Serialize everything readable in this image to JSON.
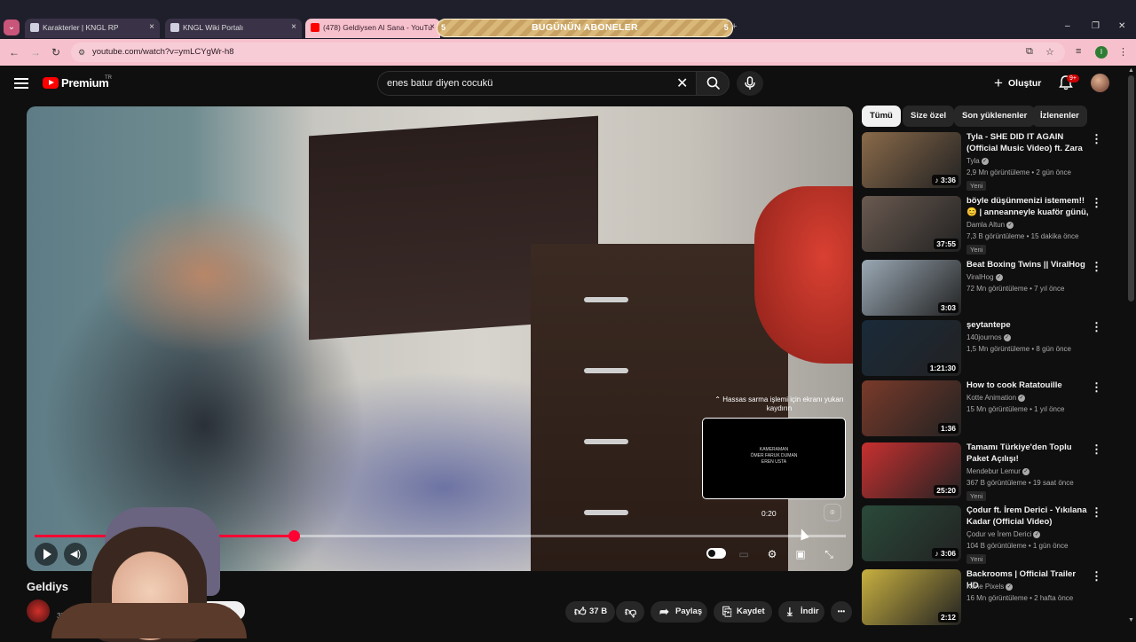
{
  "browser": {
    "tabs": [
      {
        "title": "Karakterler | KNGL RP",
        "close": "×"
      },
      {
        "title": "KNGL Wiki Portalı",
        "close": "×"
      },
      {
        "title": "(478) Geldiysen Al Sana - YouTu",
        "close": "×"
      }
    ],
    "banner": {
      "text": "BUGÜNÜN ABONELER",
      "left_num": "5",
      "right_num": "5"
    },
    "new_tab": "+",
    "url": "youtube.com/watch?v=ymLCYgWr-h8",
    "window_controls": [
      "–",
      "❐",
      "✕"
    ],
    "profile_letter": "I"
  },
  "header": {
    "logo_text": "Premium",
    "logo_region": "TR",
    "search_value": "enes batur diyen cocukü",
    "create_label": "Oluştur",
    "notification_count": "9+"
  },
  "player": {
    "scrub_hint": "Hassas sarma işlemi için ekranı yukarı kaydırın",
    "preview_credits": [
      "KAMERAMAN",
      "ÖMER FARUK DUMAN",
      "EREN USTA"
    ],
    "preview_time": "0:20",
    "progress_played": 0.32
  },
  "video": {
    "title": "Geldiys",
    "subscribers": "37 B",
    "join_label": "Katıl",
    "join_visible": "ne ol",
    "likes": "37 B",
    "share_label": "Paylaş",
    "save_label": "Kaydet",
    "download_label": "İndir",
    "more": "•••"
  },
  "chips": [
    "Tümü",
    "Size özel",
    "Son yüklenenler",
    "İzlenenler"
  ],
  "recommendations": [
    {
      "title": "Tyla - SHE DID IT AGAIN (Official Music Video) ft. Zara ...",
      "channel": "Tyla",
      "verified": true,
      "meta": "2,9 Mn görüntüleme • 2 gün önce",
      "badge": "Yeni",
      "duration": "♪ 3:36",
      "thumb_color": "#8a6a4a"
    },
    {
      "title": "böyle düşünmenizi istemem!! 😊 | anneanneyle kuaför günü, ...",
      "channel": "Damla Altun",
      "verified": true,
      "meta": "7,3 B görüntüleme • 15 dakika önce",
      "badge": "Yeni",
      "duration": "37:55",
      "thumb_color": "#6a5a50"
    },
    {
      "title": "Beat Boxing Twins || ViralHog",
      "channel": "ViralHog",
      "verified": true,
      "meta": "72 Mn görüntüleme • 7 yıl önce",
      "badge": "",
      "duration": "3:03",
      "thumb_color": "#9aa8b4"
    },
    {
      "title": "şeytantepe",
      "channel": "140journos",
      "verified": true,
      "meta": "1,5 Mn görüntüleme • 8 gün önce",
      "badge": "",
      "duration": "1:21:30",
      "thumb_color": "#1a2a3a"
    },
    {
      "title": "How to cook Ratatouille",
      "channel": "Kotte Animation",
      "verified": true,
      "meta": "15 Mn görüntüleme • 1 yıl önce",
      "badge": "",
      "duration": "1:36",
      "thumb_color": "#7a3a2a"
    },
    {
      "title": "Tamamı Türkiye'den Toplu Paket Açılışı!",
      "channel": "Mendebur Lemur",
      "verified": true,
      "meta": "367 B görüntüleme • 19 saat önce",
      "badge": "Yeni",
      "duration": "25:20",
      "thumb_color": "#c83030"
    },
    {
      "title": "Çodur ft. İrem Derici - Yıkılana Kadar (Official Video)",
      "channel": "Çodur ve İrem Derici",
      "verified": true,
      "meta": "104 B görüntüleme • 1 gün önce",
      "badge": "Yeni",
      "duration": "♪ 3:06",
      "thumb_color": "#2a4a3a"
    },
    {
      "title": "Backrooms | Official Trailer HD",
      "channel": "Kane Pixels",
      "verified": true,
      "meta": "16 Mn görüntüleme • 2 hafta önce",
      "badge": "",
      "duration": "2:12",
      "thumb_color": "#c8b040"
    }
  ]
}
